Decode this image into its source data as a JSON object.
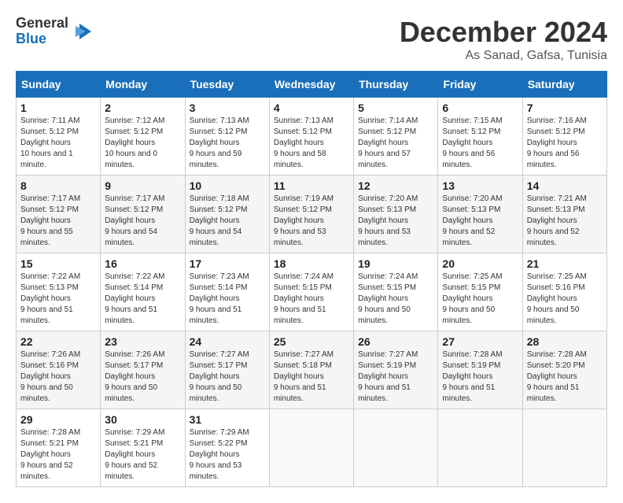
{
  "logo": {
    "general": "General",
    "blue": "Blue"
  },
  "header": {
    "month": "December 2024",
    "location": "As Sanad, Gafsa, Tunisia"
  },
  "weekdays": [
    "Sunday",
    "Monday",
    "Tuesday",
    "Wednesday",
    "Thursday",
    "Friday",
    "Saturday"
  ],
  "weeks": [
    [
      {
        "day": "1",
        "sunrise": "7:11 AM",
        "sunset": "5:12 PM",
        "daylight": "10 hours and 1 minute."
      },
      {
        "day": "2",
        "sunrise": "7:12 AM",
        "sunset": "5:12 PM",
        "daylight": "10 hours and 0 minutes."
      },
      {
        "day": "3",
        "sunrise": "7:13 AM",
        "sunset": "5:12 PM",
        "daylight": "9 hours and 59 minutes."
      },
      {
        "day": "4",
        "sunrise": "7:13 AM",
        "sunset": "5:12 PM",
        "daylight": "9 hours and 58 minutes."
      },
      {
        "day": "5",
        "sunrise": "7:14 AM",
        "sunset": "5:12 PM",
        "daylight": "9 hours and 57 minutes."
      },
      {
        "day": "6",
        "sunrise": "7:15 AM",
        "sunset": "5:12 PM",
        "daylight": "9 hours and 56 minutes."
      },
      {
        "day": "7",
        "sunrise": "7:16 AM",
        "sunset": "5:12 PM",
        "daylight": "9 hours and 56 minutes."
      }
    ],
    [
      {
        "day": "8",
        "sunrise": "7:17 AM",
        "sunset": "5:12 PM",
        "daylight": "9 hours and 55 minutes."
      },
      {
        "day": "9",
        "sunrise": "7:17 AM",
        "sunset": "5:12 PM",
        "daylight": "9 hours and 54 minutes."
      },
      {
        "day": "10",
        "sunrise": "7:18 AM",
        "sunset": "5:12 PM",
        "daylight": "9 hours and 54 minutes."
      },
      {
        "day": "11",
        "sunrise": "7:19 AM",
        "sunset": "5:12 PM",
        "daylight": "9 hours and 53 minutes."
      },
      {
        "day": "12",
        "sunrise": "7:20 AM",
        "sunset": "5:13 PM",
        "daylight": "9 hours and 53 minutes."
      },
      {
        "day": "13",
        "sunrise": "7:20 AM",
        "sunset": "5:13 PM",
        "daylight": "9 hours and 52 minutes."
      },
      {
        "day": "14",
        "sunrise": "7:21 AM",
        "sunset": "5:13 PM",
        "daylight": "9 hours and 52 minutes."
      }
    ],
    [
      {
        "day": "15",
        "sunrise": "7:22 AM",
        "sunset": "5:13 PM",
        "daylight": "9 hours and 51 minutes."
      },
      {
        "day": "16",
        "sunrise": "7:22 AM",
        "sunset": "5:14 PM",
        "daylight": "9 hours and 51 minutes."
      },
      {
        "day": "17",
        "sunrise": "7:23 AM",
        "sunset": "5:14 PM",
        "daylight": "9 hours and 51 minutes."
      },
      {
        "day": "18",
        "sunrise": "7:24 AM",
        "sunset": "5:15 PM",
        "daylight": "9 hours and 51 minutes."
      },
      {
        "day": "19",
        "sunrise": "7:24 AM",
        "sunset": "5:15 PM",
        "daylight": "9 hours and 50 minutes."
      },
      {
        "day": "20",
        "sunrise": "7:25 AM",
        "sunset": "5:15 PM",
        "daylight": "9 hours and 50 minutes."
      },
      {
        "day": "21",
        "sunrise": "7:25 AM",
        "sunset": "5:16 PM",
        "daylight": "9 hours and 50 minutes."
      }
    ],
    [
      {
        "day": "22",
        "sunrise": "7:26 AM",
        "sunset": "5:16 PM",
        "daylight": "9 hours and 50 minutes."
      },
      {
        "day": "23",
        "sunrise": "7:26 AM",
        "sunset": "5:17 PM",
        "daylight": "9 hours and 50 minutes."
      },
      {
        "day": "24",
        "sunrise": "7:27 AM",
        "sunset": "5:17 PM",
        "daylight": "9 hours and 50 minutes."
      },
      {
        "day": "25",
        "sunrise": "7:27 AM",
        "sunset": "5:18 PM",
        "daylight": "9 hours and 51 minutes."
      },
      {
        "day": "26",
        "sunrise": "7:27 AM",
        "sunset": "5:19 PM",
        "daylight": "9 hours and 51 minutes."
      },
      {
        "day": "27",
        "sunrise": "7:28 AM",
        "sunset": "5:19 PM",
        "daylight": "9 hours and 51 minutes."
      },
      {
        "day": "28",
        "sunrise": "7:28 AM",
        "sunset": "5:20 PM",
        "daylight": "9 hours and 51 minutes."
      }
    ],
    [
      {
        "day": "29",
        "sunrise": "7:28 AM",
        "sunset": "5:21 PM",
        "daylight": "9 hours and 52 minutes."
      },
      {
        "day": "30",
        "sunrise": "7:29 AM",
        "sunset": "5:21 PM",
        "daylight": "9 hours and 52 minutes."
      },
      {
        "day": "31",
        "sunrise": "7:29 AM",
        "sunset": "5:22 PM",
        "daylight": "9 hours and 53 minutes."
      },
      null,
      null,
      null,
      null
    ]
  ]
}
